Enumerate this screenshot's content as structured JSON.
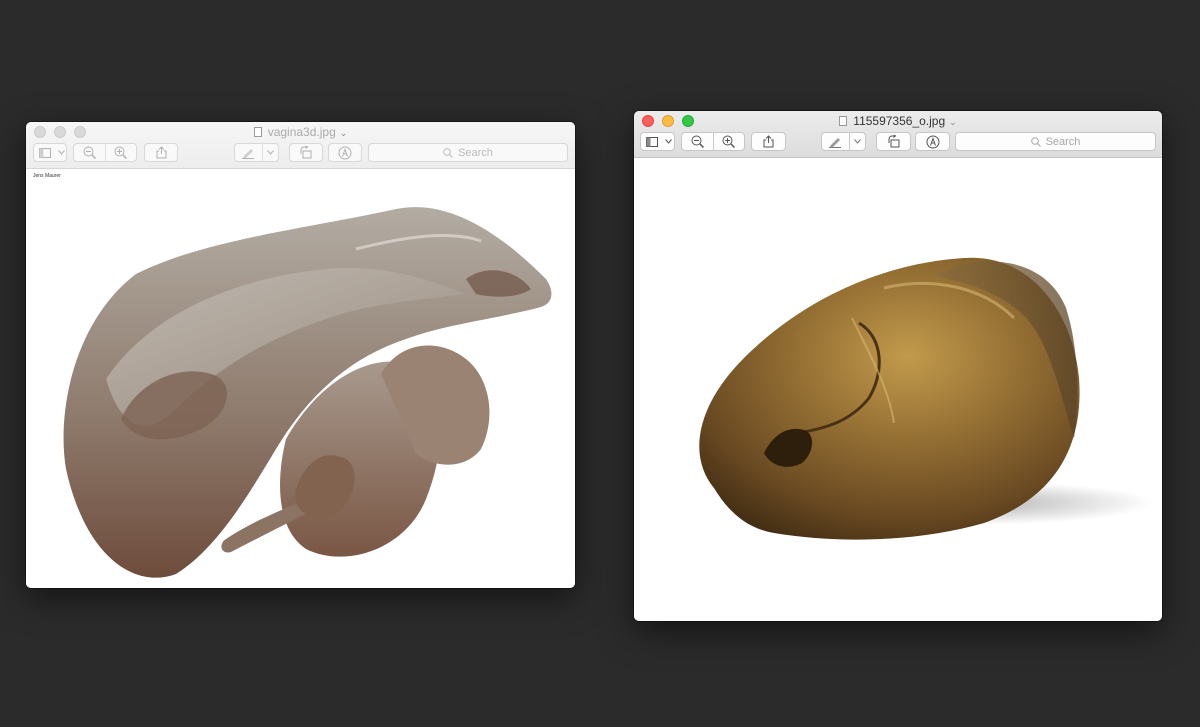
{
  "desktop": {
    "background": "#2b2b2b"
  },
  "windows": [
    {
      "title": "vagina3d.jpg",
      "active": false,
      "image_caption": "Jens Maurer",
      "image_description": "3D rendered anatomical sculpture, beige-brown",
      "search": {
        "placeholder": "Search"
      }
    },
    {
      "title": "115597356_o.jpg",
      "active": true,
      "image_description": "bronze sleeping head sculpture",
      "search": {
        "placeholder": "Search"
      }
    }
  ],
  "toolbar_icons": [
    "sidebar-icon",
    "chevron-down-icon",
    "zoom-out-icon",
    "zoom-in-icon",
    "share-icon",
    "markup-pen-icon",
    "rotate-icon",
    "annotate-icon",
    "search-icon"
  ],
  "colors": {
    "close": "#fc605b",
    "minimize": "#fdbc40",
    "maximize": "#34c84a"
  }
}
